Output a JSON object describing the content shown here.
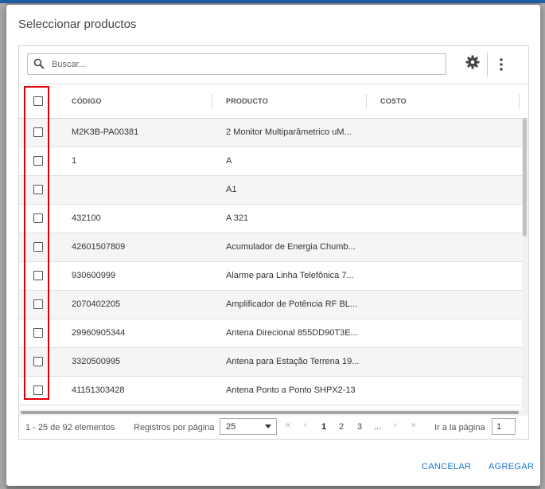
{
  "dialog": {
    "title": "Seleccionar productos",
    "search_placeholder": "Buscar...",
    "icons": {
      "search": "search-icon",
      "settings": "gear-icon",
      "more": "more-vertical-icon"
    }
  },
  "columns": {
    "code": "CÓDIGO",
    "product": "PRODUCTO",
    "cost": "COSTO"
  },
  "rows": [
    {
      "code": "M2K3B-PA00381",
      "product": "2 Monitor Multiparâmetrico uM..."
    },
    {
      "code": "1",
      "product": "A"
    },
    {
      "code": "",
      "product": "A1"
    },
    {
      "code": "432100",
      "product": "A 321"
    },
    {
      "code": "42601507809",
      "product": "Acumulador de Energia Chumb..."
    },
    {
      "code": "930600999",
      "product": "Alarme para Linha Telefônica 7..."
    },
    {
      "code": "2070402205",
      "product": "Amplificador de Potência RF BL..."
    },
    {
      "code": "29960905344",
      "product": "Antena Direcional 855DD90T3E..."
    },
    {
      "code": "3320500995",
      "product": "Antena para Estação Terrena 19..."
    },
    {
      "code": "41151303428",
      "product": "Antena Ponto a Ponto SHPX2-13"
    }
  ],
  "pager": {
    "range": "1 - 25 de 92 elementos",
    "per_page_label": "Registros por página",
    "per_page_value": "25",
    "first": "«",
    "prev": "‹",
    "pages": [
      "1",
      "2",
      "3"
    ],
    "ellipsis": "...",
    "next": "›",
    "last": "»",
    "goto_label": "Ir a la página",
    "goto_value": "1",
    "current_page": "1"
  },
  "actions": {
    "cancel": "CANCELAR",
    "add": "AGREGAR"
  },
  "colors": {
    "accent": "#1976d2",
    "highlight": "#e0000a"
  }
}
